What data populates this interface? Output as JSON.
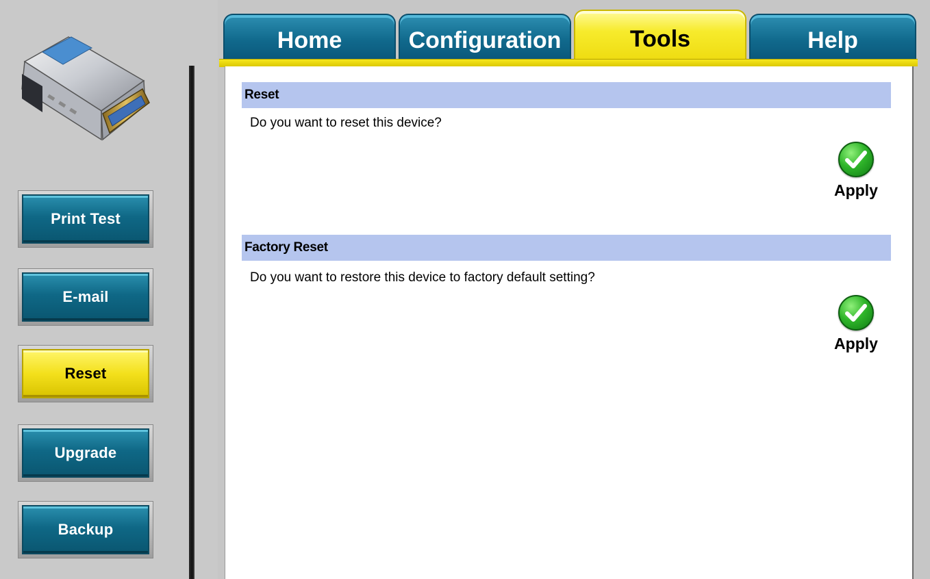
{
  "tabs": [
    {
      "label": "Home",
      "active": false
    },
    {
      "label": "Configuration",
      "active": false
    },
    {
      "label": "Tools",
      "active": true
    },
    {
      "label": "Help",
      "active": false
    }
  ],
  "sidebar": {
    "items": [
      {
        "label": "Print Test",
        "active": false
      },
      {
        "label": "E-mail",
        "active": false
      },
      {
        "label": "Reset",
        "active": true
      },
      {
        "label": "Upgrade",
        "active": false
      },
      {
        "label": "Backup",
        "active": false
      }
    ]
  },
  "sections": [
    {
      "title": "Reset",
      "question": "Do you want to reset this device?",
      "apply_label": "Apply",
      "apply_icon": "checkmark-icon"
    },
    {
      "title": "Factory Reset",
      "question": "Do you want to restore this device to factory default setting?",
      "apply_label": "Apply",
      "apply_icon": "checkmark-icon"
    }
  ],
  "colors": {
    "tab_blue": "#116a8d",
    "tab_active_yellow": "#f7eb2c",
    "section_header": "#b5c5ee",
    "apply_green": "#2fb52a"
  }
}
